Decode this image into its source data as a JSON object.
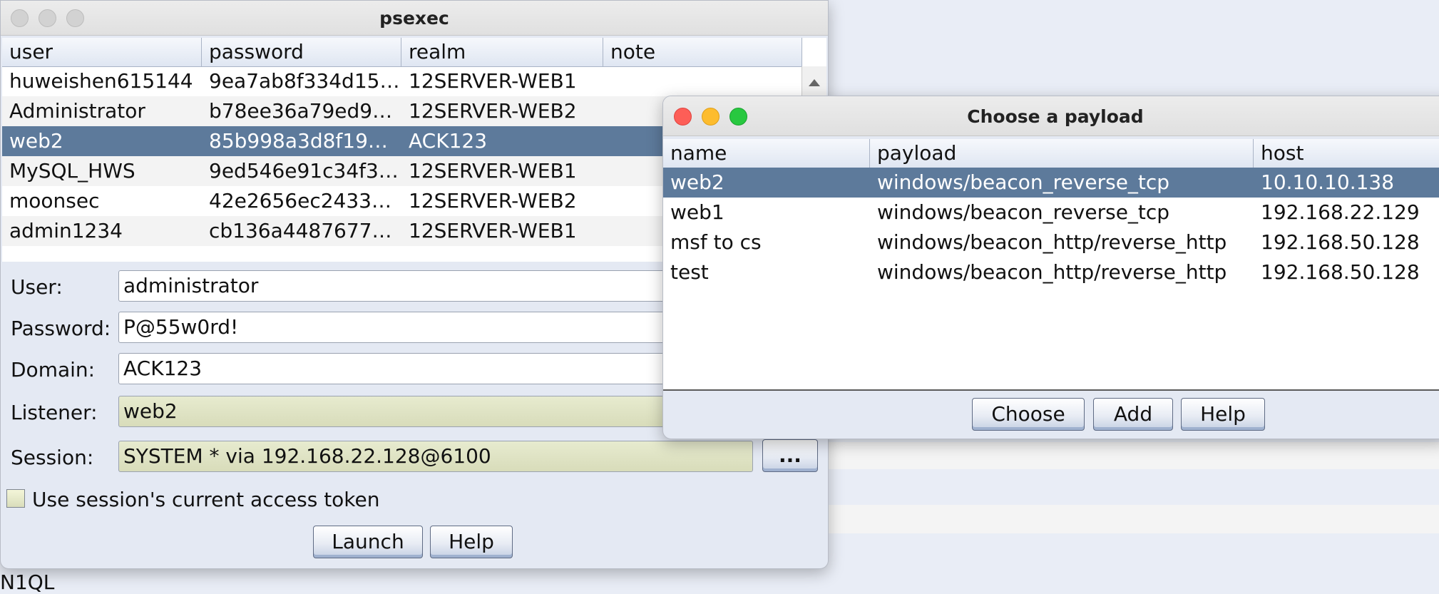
{
  "background": {
    "partial_text": "N1QL"
  },
  "psexec": {
    "title": "psexec",
    "table": {
      "columns": [
        "user",
        "password",
        "realm",
        "note"
      ],
      "rows": [
        {
          "user": "huweishen615144",
          "password": "9ea7ab8f334d15…",
          "realm": "12SERVER-WEB1",
          "note": ""
        },
        {
          "user": "Administrator",
          "password": "b78ee36a79ed9…",
          "realm": "12SERVER-WEB2",
          "note": ""
        },
        {
          "user": "web2",
          "password": "85b998a3d8f19…",
          "realm": "ACK123",
          "note": ""
        },
        {
          "user": "MySQL_HWS",
          "password": "9ed546e91c34f3…",
          "realm": "12SERVER-WEB1",
          "note": ""
        },
        {
          "user": "moonsec",
          "password": "42e2656ec2433…",
          "realm": "12SERVER-WEB2",
          "note": ""
        },
        {
          "user": "admin1234",
          "password": "cb136a4487677…",
          "realm": "12SERVER-WEB1",
          "note": ""
        }
      ],
      "selected_index": 2
    },
    "form": {
      "user_label": "User:",
      "user_value": "administrator",
      "password_label": "Password:",
      "password_value": "P@55w0rd!",
      "domain_label": "Domain:",
      "domain_value": "ACK123",
      "listener_label": "Listener:",
      "listener_value": "web2",
      "session_label": "Session:",
      "session_value": "SYSTEM * via  192.168.22.128@6100",
      "session_button": "...",
      "token_checkbox_label": "Use session's current access token",
      "token_checked": false
    },
    "buttons": {
      "launch": "Launch",
      "help": "Help"
    }
  },
  "payload_dialog": {
    "title": "Choose a payload",
    "table": {
      "columns": [
        "name",
        "payload",
        "host"
      ],
      "rows": [
        {
          "name": "web2",
          "payload": "windows/beacon_reverse_tcp",
          "host": "10.10.10.138"
        },
        {
          "name": "web1",
          "payload": "windows/beacon_reverse_tcp",
          "host": "192.168.22.129"
        },
        {
          "name": "msf to cs",
          "payload": "windows/beacon_http/reverse_http",
          "host": "192.168.50.128"
        },
        {
          "name": "test",
          "payload": "windows/beacon_http/reverse_http",
          "host": "192.168.50.128"
        }
      ],
      "selected_index": 0
    },
    "buttons": {
      "choose": "Choose",
      "add": "Add",
      "help": "Help"
    }
  },
  "colors": {
    "selection": "#5d7a9b",
    "readonly_field": "#e1e5c5",
    "window_bg": "#e4e9f3"
  }
}
